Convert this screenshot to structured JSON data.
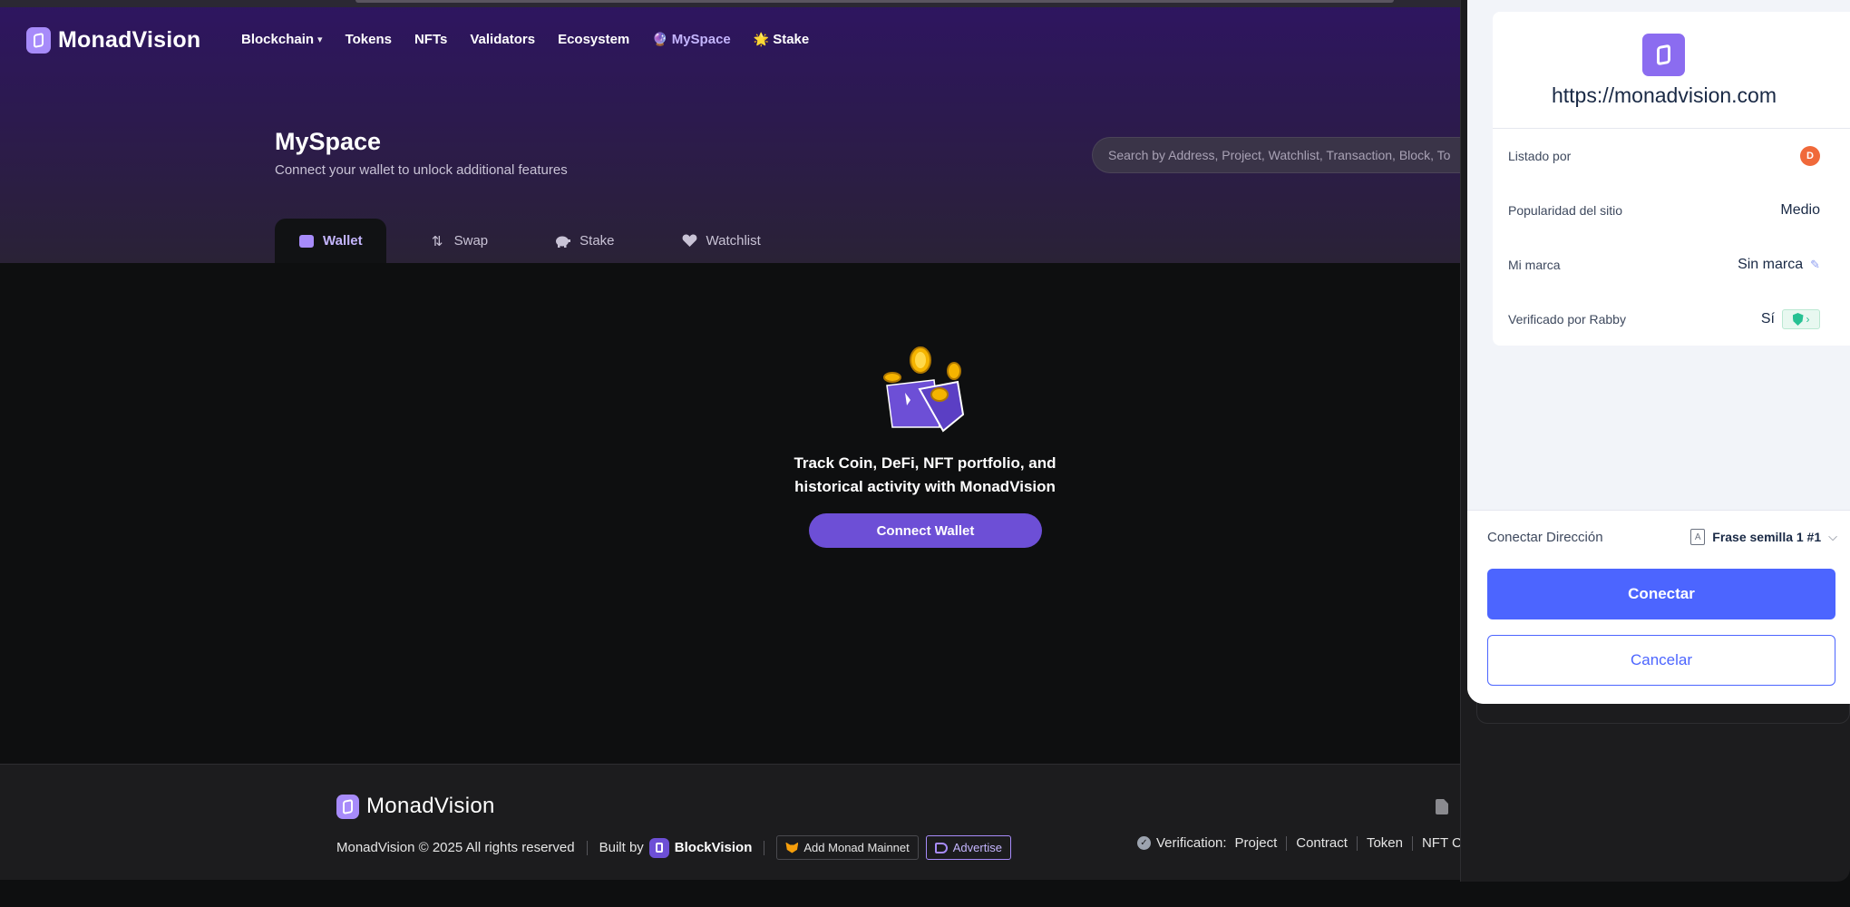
{
  "header": {
    "brand": "MonadVision",
    "nav": [
      {
        "label": "Blockchain",
        "caret": "▾"
      },
      {
        "label": "Tokens"
      },
      {
        "label": "NFTs"
      },
      {
        "label": "Validators"
      },
      {
        "label": "Ecosystem"
      },
      {
        "label": "MySpace",
        "emoji": "🔮"
      },
      {
        "label": "Stake",
        "emoji": "🌟"
      }
    ]
  },
  "page": {
    "title": "MySpace",
    "subtitle": "Connect your wallet to unlock additional features",
    "search_placeholder": "Search by Address, Project, Watchlist, Transaction, Block, To"
  },
  "tabs": [
    {
      "label": "Wallet",
      "icon": "wallet-icon",
      "active": true
    },
    {
      "label": "Swap",
      "icon": "swap-icon"
    },
    {
      "label": "Stake",
      "icon": "piggy-bank-icon"
    },
    {
      "label": "Watchlist",
      "icon": "heart-icon"
    }
  ],
  "main": {
    "message_line1": "Track Coin, DeFi, NFT portfolio, and",
    "message_line2": "historical activity with MonadVision",
    "connect_button": "Connect Wallet"
  },
  "footer": {
    "brand": "MonadVision",
    "copyright": "MonadVision © 2025 All rights reserved",
    "built_by": "Built by",
    "built_by_brand": "BlockVision",
    "add_mainnet": "Add Monad Mainnet",
    "advertise": "Advertise",
    "verification_label": "Verification:",
    "verification_links": [
      "Project",
      "Contract",
      "Token",
      "NFT C"
    ]
  },
  "popup": {
    "site_url": "https://monadvision.com",
    "rows": [
      {
        "label": "Listado por",
        "value": ""
      },
      {
        "label": "Popularidad del sitio",
        "value": "Medio"
      },
      {
        "label": "Mi marca",
        "value": "Sin marca"
      },
      {
        "label": "Verificado por Rabby",
        "value": "Sí"
      }
    ],
    "connect_address_label": "Conectar Dirección",
    "account_name": "Frase semilla 1 #1",
    "account_icon_letter": "A",
    "connect_button": "Conectar",
    "cancel_button": "Cancelar"
  },
  "colors": {
    "accent_purple": "#6d4fd6",
    "rabby_blue": "#4c65ff",
    "verified_green": "#27c193"
  }
}
